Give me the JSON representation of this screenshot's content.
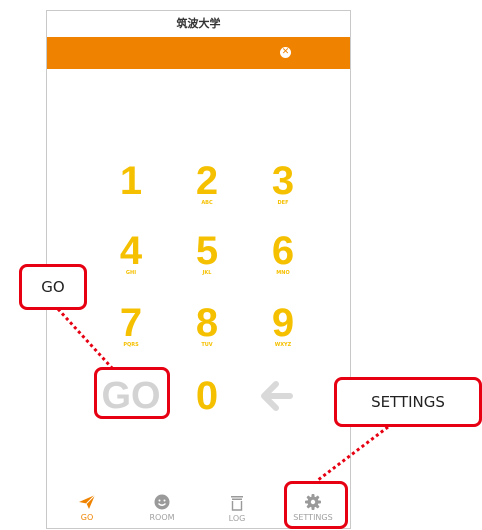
{
  "header": {
    "title": "筑波大学"
  },
  "banner": {
    "close_icon": "close-circle-icon"
  },
  "keypad": {
    "keys": [
      {
        "digit": "1",
        "letters": ""
      },
      {
        "digit": "2",
        "letters": "ABC"
      },
      {
        "digit": "3",
        "letters": "DEF"
      },
      {
        "digit": "4",
        "letters": "GHI"
      },
      {
        "digit": "5",
        "letters": "JKL"
      },
      {
        "digit": "6",
        "letters": "MNO"
      },
      {
        "digit": "7",
        "letters": "PQRS"
      },
      {
        "digit": "8",
        "letters": "TUV"
      },
      {
        "digit": "9",
        "letters": "WXYZ"
      }
    ],
    "go_label": "GO",
    "zero": "0",
    "back_icon": "left-arrow-icon"
  },
  "tabs": [
    {
      "label": "GO",
      "icon": "paper-plane-icon",
      "active": true
    },
    {
      "label": "ROOM",
      "icon": "smiley-icon",
      "active": false
    },
    {
      "label": "LOG",
      "icon": "trash-icon",
      "active": false
    },
    {
      "label": "SETTINGS",
      "icon": "gear-icon",
      "active": false
    }
  ],
  "annotations": {
    "go_callout": "GO",
    "settings_callout": "SETTINGS"
  },
  "colors": {
    "accent": "#ef8300",
    "digit": "#f5c000",
    "callout": "#e60012",
    "inactive": "#a0a0a0"
  }
}
